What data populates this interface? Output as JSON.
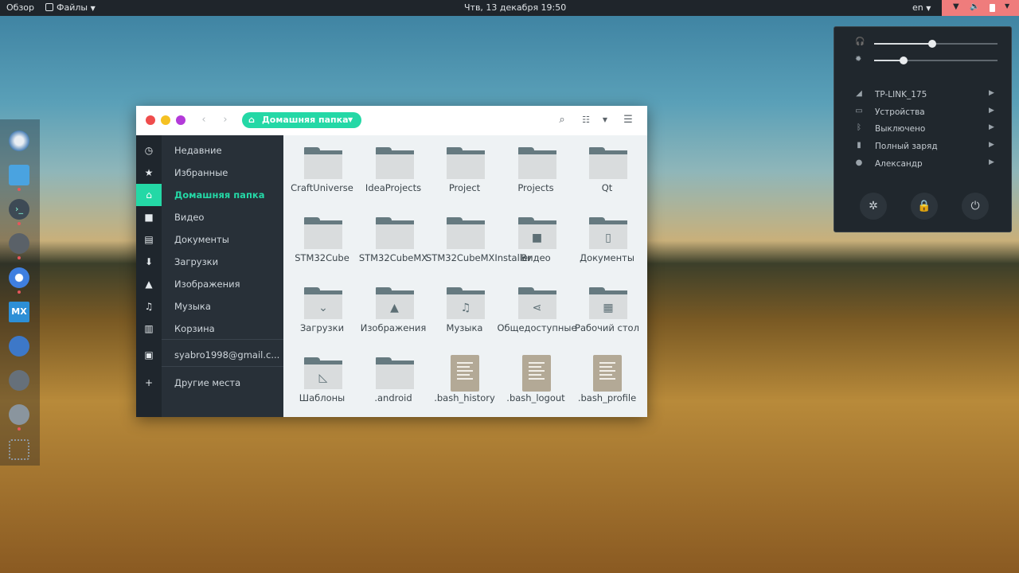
{
  "topbar": {
    "overview": "Обзор",
    "files_menu": "Файлы",
    "clock": "Чтв, 13 декабря  19:50",
    "language": "en"
  },
  "file_window": {
    "breadcrumb": "Домашняя папка",
    "sidebar": [
      {
        "icon": "history-icon",
        "label": "Недавние"
      },
      {
        "icon": "star-icon",
        "label": "Избранные"
      },
      {
        "icon": "home-icon",
        "label": "Домашняя папка",
        "active": true
      },
      {
        "icon": "video-icon",
        "label": "Видео"
      },
      {
        "icon": "document-icon",
        "label": "Документы"
      },
      {
        "icon": "download-icon",
        "label": "Загрузки"
      },
      {
        "icon": "image-icon",
        "label": "Изображения"
      },
      {
        "icon": "music-icon",
        "label": "Музыка"
      },
      {
        "icon": "trash-icon",
        "label": "Корзина"
      },
      {
        "icon": "drive-icon",
        "label": "syabro1998@gmail.c..."
      },
      {
        "icon": "plus-icon",
        "label": "Другие места"
      }
    ],
    "items": [
      {
        "name": "CraftUniverse",
        "kind": "folder"
      },
      {
        "name": "IdeaProjects",
        "kind": "folder"
      },
      {
        "name": "Project",
        "kind": "folder"
      },
      {
        "name": "Projects",
        "kind": "folder"
      },
      {
        "name": "Qt",
        "kind": "folder"
      },
      {
        "name": "STM32Cube",
        "kind": "folder"
      },
      {
        "name": "STM32CubeMX",
        "kind": "folder"
      },
      {
        "name": "STM32CubeMXInstaller",
        "kind": "folder"
      },
      {
        "name": "Видео",
        "kind": "folder",
        "glyph": "camera-icon"
      },
      {
        "name": "Документы",
        "kind": "folder",
        "glyph": "document-icon"
      },
      {
        "name": "Загрузки",
        "kind": "folder",
        "glyph": "download-icon"
      },
      {
        "name": "Изображения",
        "kind": "folder",
        "glyph": "image-icon"
      },
      {
        "name": "Музыка",
        "kind": "folder",
        "glyph": "music-icon"
      },
      {
        "name": "Общедоступные",
        "kind": "folder",
        "glyph": "share-icon"
      },
      {
        "name": "Рабочий стол",
        "kind": "folder",
        "glyph": "desktop-icon"
      },
      {
        "name": "Шаблоны",
        "kind": "folder",
        "glyph": "template-icon"
      },
      {
        "name": ".android",
        "kind": "folder"
      },
      {
        "name": ".bash_history",
        "kind": "file"
      },
      {
        "name": ".bash_logout",
        "kind": "file"
      },
      {
        "name": ".bash_profile",
        "kind": "file"
      },
      {
        "name": "",
        "kind": "file"
      },
      {
        "name": "",
        "kind": "file"
      },
      {
        "name": "",
        "kind": "folder"
      },
      {
        "name": "",
        "kind": "folder"
      },
      {
        "name": "",
        "kind": "folder"
      }
    ]
  },
  "system_menu": {
    "volume_level": 0.47,
    "brightness_level": 0.24,
    "rows": [
      {
        "icon": "wifi-icon",
        "label": "TP-LINK_175"
      },
      {
        "icon": "devices-icon",
        "label": "Устройства"
      },
      {
        "icon": "bluetooth-icon",
        "label": "Выключено"
      },
      {
        "icon": "battery-icon",
        "label": "Полный заряд"
      },
      {
        "icon": "user-icon",
        "label": "Александр"
      }
    ],
    "buttons": [
      "settings-button",
      "lock-button",
      "power-button"
    ]
  },
  "colors": {
    "accent": "#24d8a6",
    "topbar": "#1f252b",
    "tray": "#ef7c7c",
    "sidebar": "#283038"
  }
}
